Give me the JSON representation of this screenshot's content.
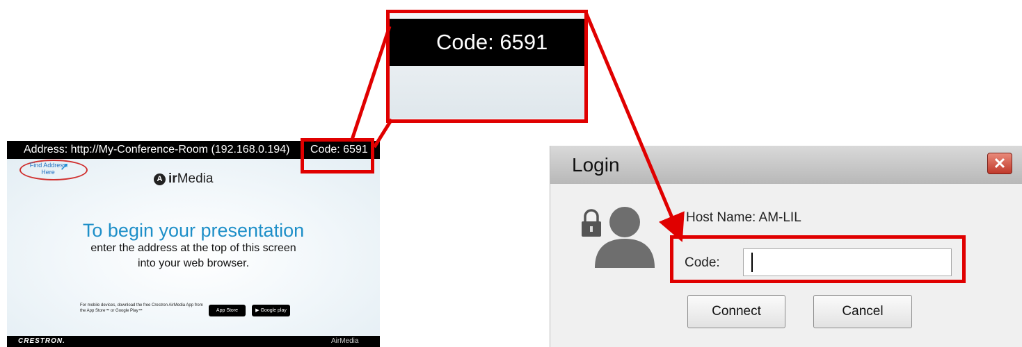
{
  "airmedia_screen": {
    "address_text": "Address: http://My-Conference-Room (192.168.0.194)",
    "code_text": "Code: 6591",
    "find_address_text": "Find Address Here",
    "logo_bold": "ir",
    "logo_light": "Media",
    "headline": "To begin your presentation",
    "subline_1": "enter the address at the top of this screen",
    "subline_2": "into your web browser.",
    "mobile_text": "For mobile devices, download the free Crestron AirMedia App from the App Store™ or Google Play™",
    "app_store_badge": "App Store",
    "google_play_badge": "Google play",
    "footer_brand": "CRESTRON.",
    "footer_logo": "AirMedia"
  },
  "zoom_inset": {
    "code_text": "Code: 6591"
  },
  "login_dialog": {
    "title": "Login",
    "close_icon": "close-icon",
    "host_name": "Host Name: AM-LIL",
    "code_label": "Code:",
    "code_value": "",
    "connect_label": "Connect",
    "cancel_label": "Cancel",
    "icons": [
      "lock-icon",
      "user-icon"
    ]
  },
  "annotation_color": "#e00000"
}
